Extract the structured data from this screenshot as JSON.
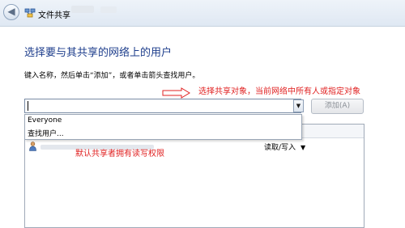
{
  "window": {
    "title": "文件共享",
    "back_glyph": "◀",
    "icon": "network-share-icon"
  },
  "heading": "选择要与其共享的网络上的用户",
  "instruction": "键入名称，然后单击“添加”，或者单击箭头查找用户。",
  "annotations": {
    "top": "选择共享对象，当前网络中所有人或指定对象",
    "permission": "默认共享者拥有读写权限",
    "color": "#e02020"
  },
  "combo": {
    "value": "",
    "arrow_glyph": "▼"
  },
  "add_button": {
    "label": "添加(A)"
  },
  "dropdown": {
    "options": [
      "Everyone",
      "查找用户..."
    ]
  },
  "share_list": {
    "rows": [
      {
        "permission": "读取/写入",
        "dropdown_glyph": "▼"
      }
    ]
  },
  "colors": {
    "heading": "#1e3e8c",
    "accent": "#2b5797"
  }
}
